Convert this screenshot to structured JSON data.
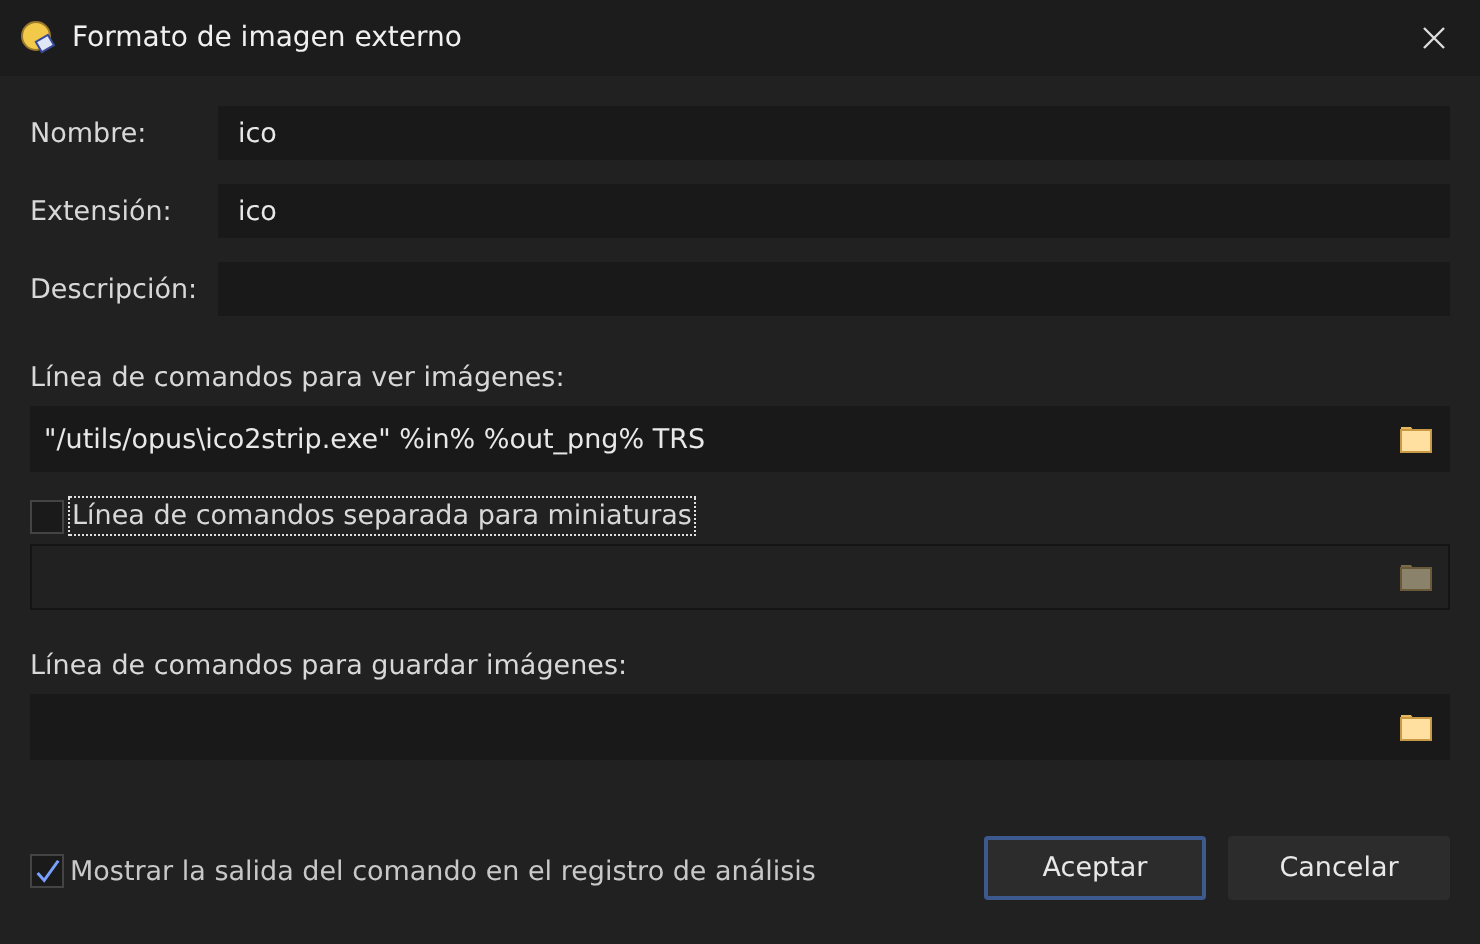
{
  "window": {
    "title": "Formato de imagen externo"
  },
  "fields": [
    {
      "label": "Nombre:",
      "value": "ico"
    },
    {
      "label": "Extensión:",
      "value": "ico"
    },
    {
      "label": "Descripción:"
    }
  ],
  "viewer": {
    "label": "Línea de comandos para ver imágenes:",
    "value": "\"/utils/opus\\ico2strip.exe\" %in% %out_png% TRS"
  },
  "thumbnail": {
    "label": "Línea de comandos separada para miniaturas",
    "checked": false,
    "focused": true
  },
  "saver": {
    "label": "Línea de comandos para guardar imágenes:"
  },
  "show_output": {
    "label": "Mostrar la salida del comando en el registro de análisis",
    "checked": true
  },
  "buttons": [
    {
      "label": "Aceptar",
      "default": true
    },
    {
      "label": "Cancelar",
      "default": false
    }
  ]
}
